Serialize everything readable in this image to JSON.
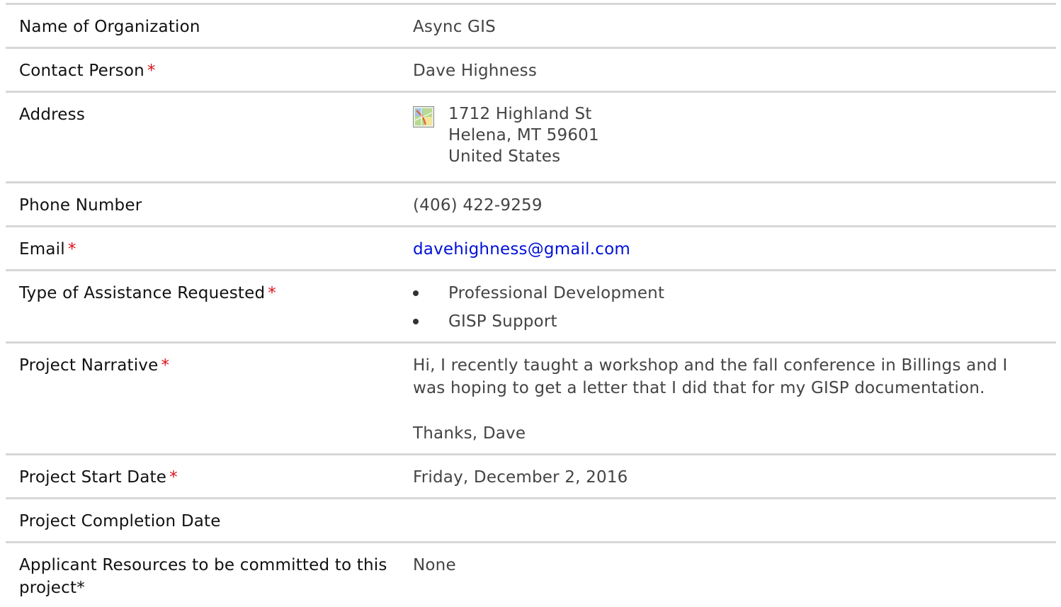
{
  "fields": [
    {
      "label": "Name of Organization",
      "required": false,
      "value": "Async GIS"
    },
    {
      "label": "Contact Person",
      "required": true,
      "value": "Dave Highness"
    },
    {
      "label": "Address",
      "required": false,
      "icon": "map-icon",
      "lines": [
        "1712 Highland St",
        "Helena, MT 59601",
        "United States"
      ]
    },
    {
      "label": "Phone Number",
      "required": false,
      "value": "(406) 422-9259"
    },
    {
      "label": "Email",
      "required": true,
      "value": "davehighness@gmail.com"
    },
    {
      "label": "Type of Assistance Requested",
      "required": true,
      "items": [
        "Professional Development",
        "GISP Support"
      ]
    },
    {
      "label": "Project Narrative",
      "required": true,
      "paragraphs": [
        "Hi, I recently taught a workshop and the fall conference in Billings and I was hoping to get a letter that I did that for my GISP documentation.",
        "Thanks, Dave"
      ]
    },
    {
      "label": "Project Start Date",
      "required": true,
      "value": "Friday, December 2, 2016"
    },
    {
      "label": "Project Completion Date",
      "required": false,
      "value": ""
    },
    {
      "label": "Applicant Resources to be committed to this project*",
      "required": false,
      "value": "None"
    }
  ],
  "required_marker": "*",
  "colors": {
    "required": "#d9111b",
    "link": "#0010d9",
    "divider": "#d7d7d7"
  }
}
